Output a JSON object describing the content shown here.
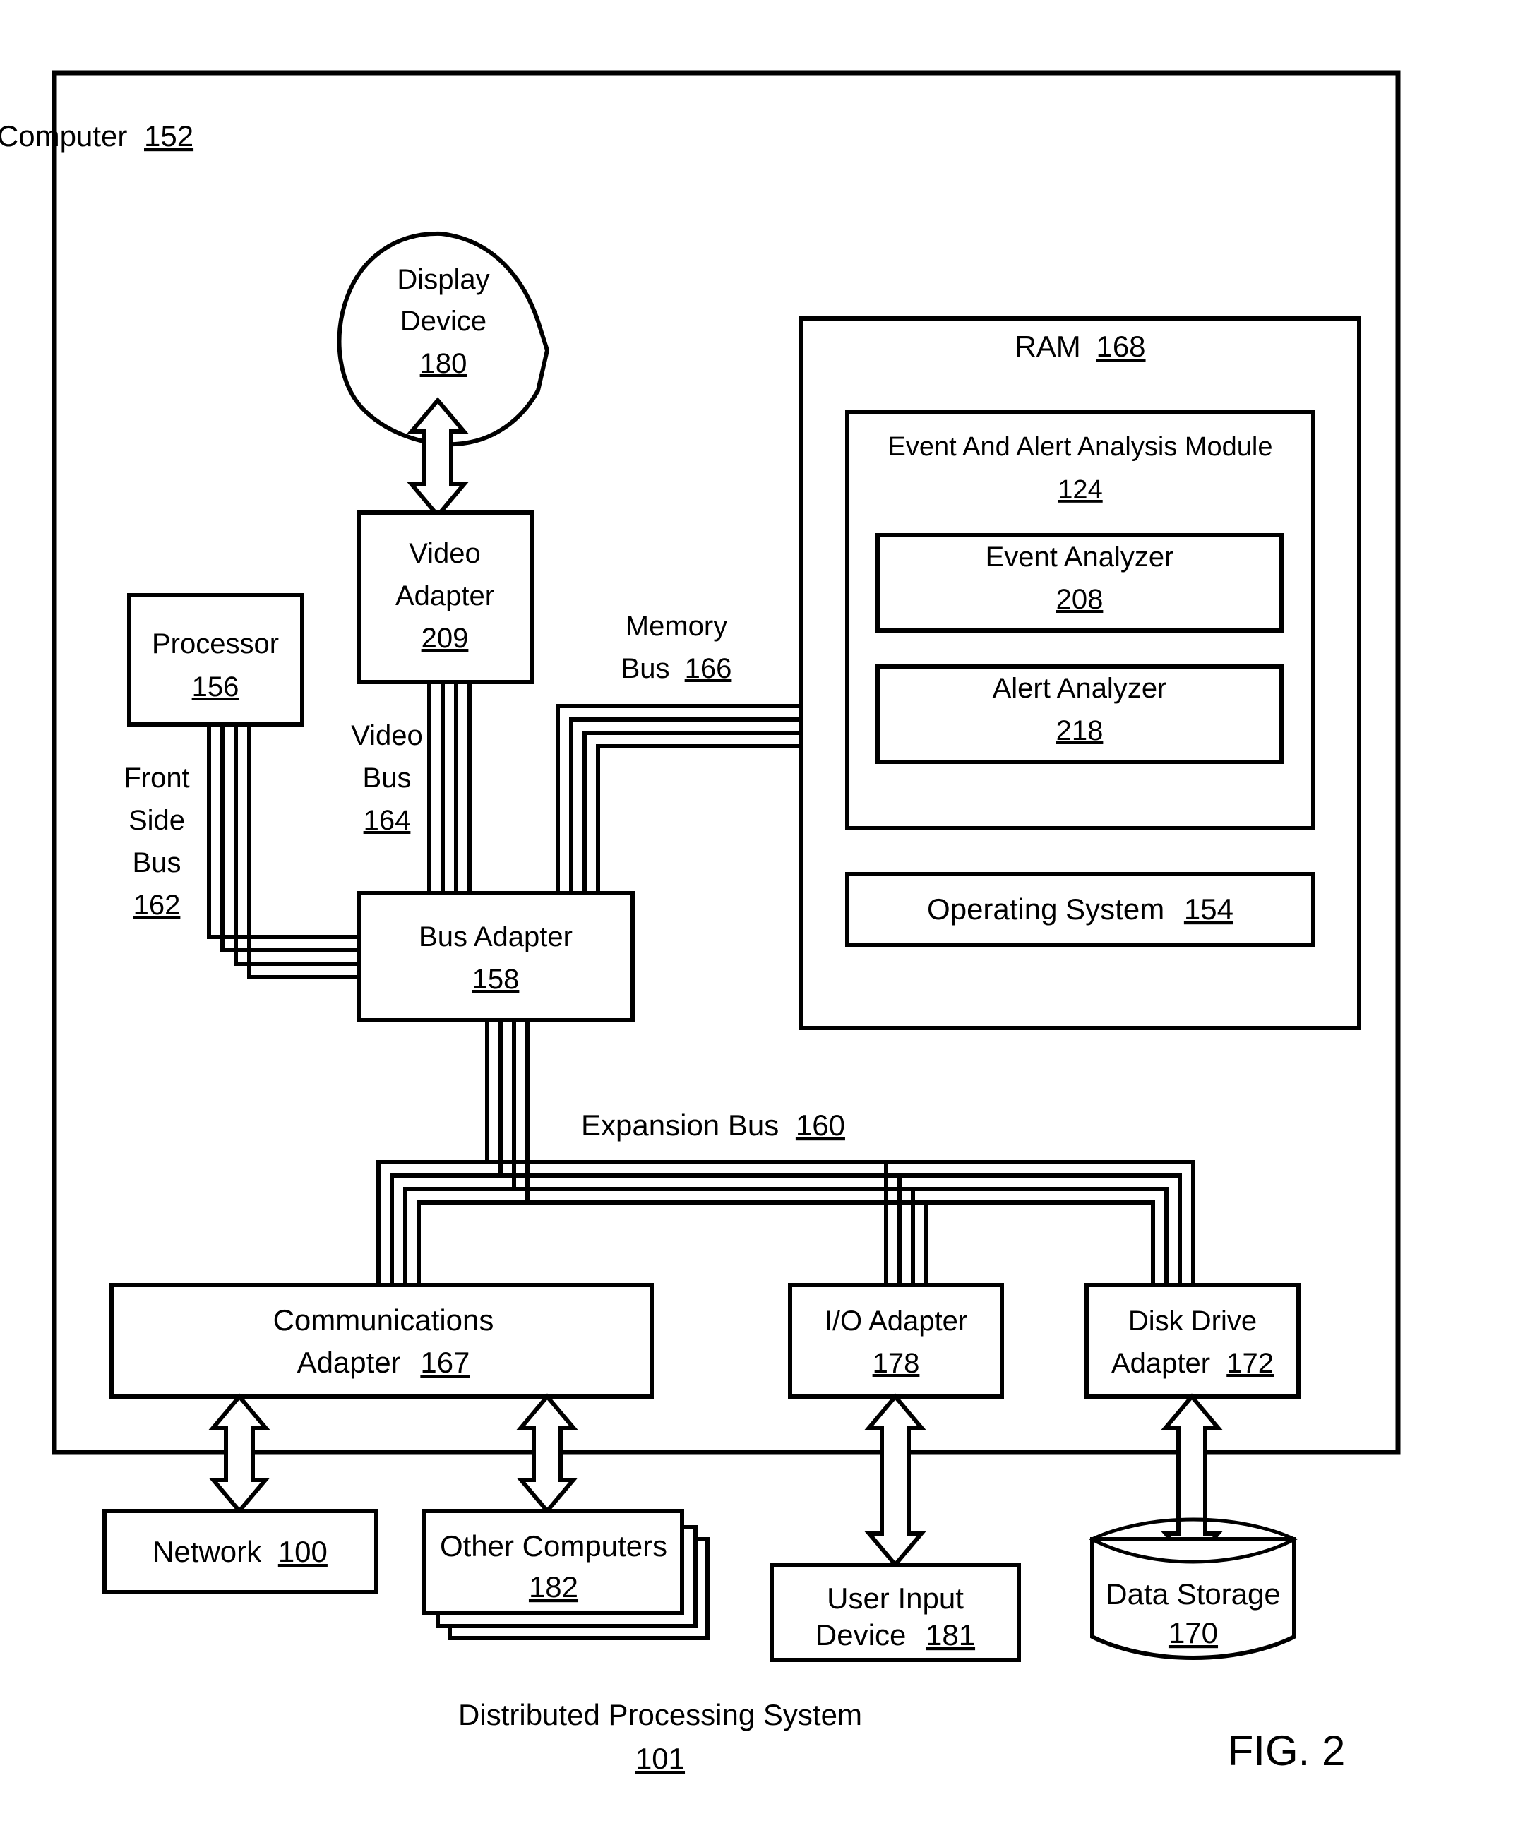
{
  "figure": {
    "label": "FIG. 2",
    "caption_line1": "Distributed Processing System",
    "caption_line2": "101"
  },
  "computer": {
    "label": "Computer",
    "ref": "152"
  },
  "display_device": {
    "line1": "Display",
    "line2": "Device",
    "ref": "180"
  },
  "video_adapter": {
    "line1": "Video",
    "line2": "Adapter",
    "ref": "209"
  },
  "processor": {
    "label": "Processor",
    "ref": "156"
  },
  "bus_adapter": {
    "label": "Bus Adapter",
    "ref": "158"
  },
  "ram": {
    "label": "RAM",
    "ref": "168",
    "module": {
      "line1": "Event And Alert Analysis Module",
      "ref": "124",
      "children": [
        {
          "label": "Event Analyzer",
          "ref": "208"
        },
        {
          "label": "Alert Analyzer",
          "ref": "218"
        }
      ]
    },
    "operating_system": {
      "label": "Operating System",
      "ref": "154"
    }
  },
  "buses": {
    "front_side": {
      "line1": "Front",
      "line2": "Side",
      "line3": "Bus",
      "ref": "162"
    },
    "video": {
      "line1": "Video",
      "line2": "Bus",
      "ref": "164"
    },
    "memory": {
      "line1": "Memory",
      "line2": "Bus",
      "ref": "166"
    },
    "expansion": {
      "label": "Expansion Bus",
      "ref": "160"
    }
  },
  "adapters": {
    "communications": {
      "line1": "Communications",
      "line2": "Adapter",
      "ref": "167"
    },
    "io": {
      "line1": "I/O Adapter",
      "ref": "178"
    },
    "disk_drive": {
      "line1": "Disk Drive",
      "line2": "Adapter",
      "ref": "172"
    }
  },
  "peripherals": {
    "network": {
      "label": "Network",
      "ref": "100"
    },
    "other_computers": {
      "label": "Other Computers",
      "ref": "182"
    },
    "user_input": {
      "line1": "User Input",
      "line2": "Device",
      "ref": "181"
    },
    "data_storage": {
      "label": "Data Storage",
      "ref": "170"
    }
  },
  "colors": {
    "stroke": "#000000",
    "fill": "#ffffff"
  }
}
